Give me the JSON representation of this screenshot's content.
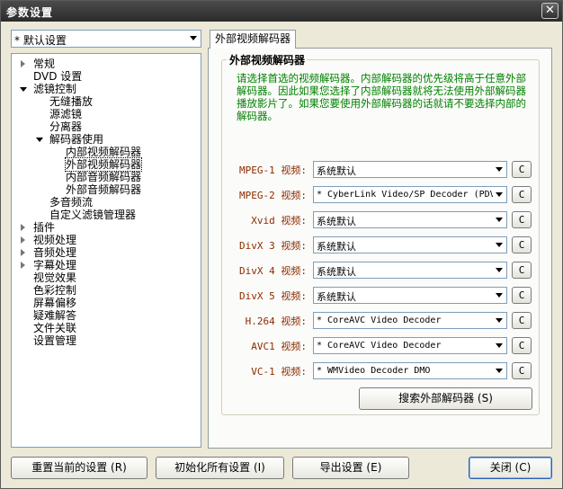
{
  "window": {
    "title": "参数设置",
    "close_glyph": "✕"
  },
  "preset": {
    "value": "* 默认设置"
  },
  "tree": [
    {
      "label": "常规",
      "expander": "collapsed"
    },
    {
      "label": "DVD 设置",
      "expander": "none"
    },
    {
      "label": "滤镜控制",
      "expander": "expanded"
    },
    {
      "label": "无缝播放",
      "expander": "none"
    },
    {
      "label": "源滤镜",
      "expander": "none"
    },
    {
      "label": "分离器",
      "expander": "none"
    },
    {
      "label": "解码器使用",
      "expander": "expanded"
    },
    {
      "label": "内部视频解码器",
      "expander": "none"
    },
    {
      "label": "外部视频解码器",
      "expander": "none",
      "selected": true
    },
    {
      "label": "内部音频解码器",
      "expander": "none"
    },
    {
      "label": "外部音频解码器",
      "expander": "none"
    },
    {
      "label": "多音频流",
      "expander": "none"
    },
    {
      "label": "自定义滤镜管理器",
      "expander": "none"
    },
    {
      "label": "插件",
      "expander": "collapsed"
    },
    {
      "label": "视频处理",
      "expander": "collapsed"
    },
    {
      "label": "音频处理",
      "expander": "collapsed"
    },
    {
      "label": "字幕处理",
      "expander": "collapsed"
    },
    {
      "label": "视觉效果",
      "expander": "none"
    },
    {
      "label": "色彩控制",
      "expander": "none"
    },
    {
      "label": "屏幕偏移",
      "expander": "none"
    },
    {
      "label": "疑难解答",
      "expander": "none"
    },
    {
      "label": "文件关联",
      "expander": "none"
    },
    {
      "label": "设置管理",
      "expander": "none"
    }
  ],
  "tab": {
    "label": "外部视频解码器"
  },
  "group": {
    "title": "外部视频解码器",
    "description": "请选择首选的视频解码器。内部解码器的优先级将高于任意外部解码器。因此如果您选择了内部解码器就将无法使用外部解码器播放影片了。如果您要使用外部解码器的话就请不要选择内部的解码器。"
  },
  "decoders": [
    {
      "label": "MPEG-1 视频:",
      "value": "系统默认",
      "mono": false,
      "button": "C"
    },
    {
      "label": "MPEG-2 视频:",
      "value": "* CyberLink Video/SP Decoder (PDV",
      "mono": true,
      "button": "C"
    },
    {
      "label": "Xvid 视频:",
      "value": "系统默认",
      "mono": false,
      "button": "C"
    },
    {
      "label": "DivX 3 视频:",
      "value": "系统默认",
      "mono": false,
      "button": "C"
    },
    {
      "label": "DivX 4 视频:",
      "value": "系统默认",
      "mono": false,
      "button": "C"
    },
    {
      "label": "DivX 5 视频:",
      "value": "系统默认",
      "mono": false,
      "button": "C"
    },
    {
      "label": "H.264 视频:",
      "value": "* CoreAVC Video Decoder",
      "mono": true,
      "button": "C"
    },
    {
      "label": "AVC1 视频:",
      "value": "* CoreAVC Video Decoder",
      "mono": true,
      "button": "C"
    },
    {
      "label": "VC-1 视频:",
      "value": "* WMVideo Decoder DMO",
      "mono": true,
      "button": "C"
    }
  ],
  "search_button": "搜索外部解码器 (S)",
  "footer": {
    "reset": "重置当前的设置 (R)",
    "init_all": "初始化所有设置 (I)",
    "export": "导出设置 (E)",
    "close": "关闭 (C)"
  }
}
